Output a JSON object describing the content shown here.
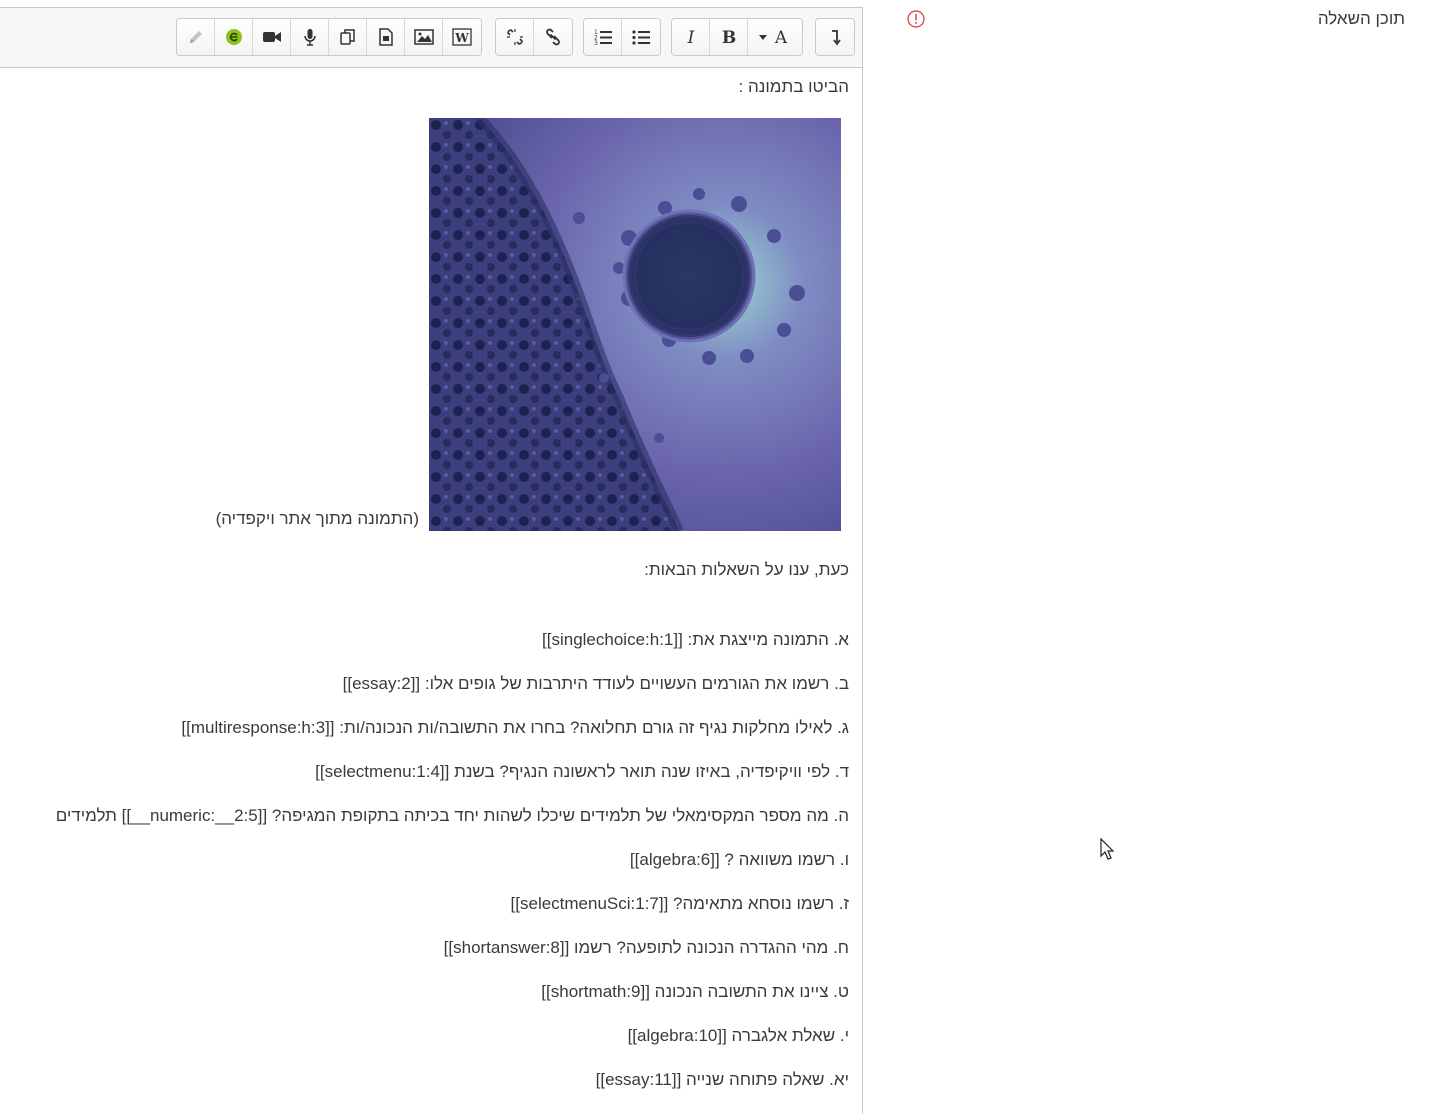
{
  "field": {
    "label": "תוכן השאלה",
    "alert_icon": "exclamation-circle-icon",
    "alert_color": "#d9534f"
  },
  "toolbar": {
    "groups": [
      [
        "pencil-icon",
        "green-equation-icon",
        "video-icon",
        "microphone-icon",
        "copy-icon",
        "media-file-icon",
        "image-icon",
        "word-import-icon"
      ],
      [
        "unlink-icon",
        "link-icon"
      ],
      [
        "ordered-list-icon",
        "unordered-list-icon"
      ],
      [
        "italic-icon",
        "bold-icon",
        "font-style-icon"
      ],
      [
        "rtl-direction-icon"
      ]
    ]
  },
  "content": {
    "intro": "הביטו בתמונה :",
    "image_caption": "(התמונה מתוך אתר ויקפדיה)",
    "prompt": "כעת, ענו על השאלות הבאות:",
    "questions": [
      "א. התמונה מייצגת את:  [[singlechoice:h:1]]",
      "ב. רשמו את הגורמים העשויים לעודד היתרבות של גופים אלו: [[essay:2]]",
      "ג. לאילו מחלקות נגיף זה גורם תחלואה? בחרו את התשובה/ות הנכונה/ות: [[multiresponse:h:3]]",
      "ד. לפי וויקיפדיה, באיזו שנה תואר לראשונה הנגיף? בשנת [[selectmenu:1:4]]",
      "ה. מה מספר המקסימאלי של תלמידים שיכלו לשהות יחד בכיתה בתקופת המגיפה?  [[2:5__:numeric__]] תלמידים",
      "ו. רשמו משוואה ?  [[algebra:6]]",
      "ז. רשמו נוסחא מתאימה?  [[selectmenuSci:1:7]]",
      "ח. מהי ההגדרה הנכונה לתופעה? רשמו [[shortanswer:8]]",
      "ט. ציינו את התשובה הנכונה [[shortmath:9]]",
      "י. שאלת אלגברה [[algebra:10]]",
      "יא. שאלה פתוחה שנייה [[essay:11]]"
    ]
  }
}
